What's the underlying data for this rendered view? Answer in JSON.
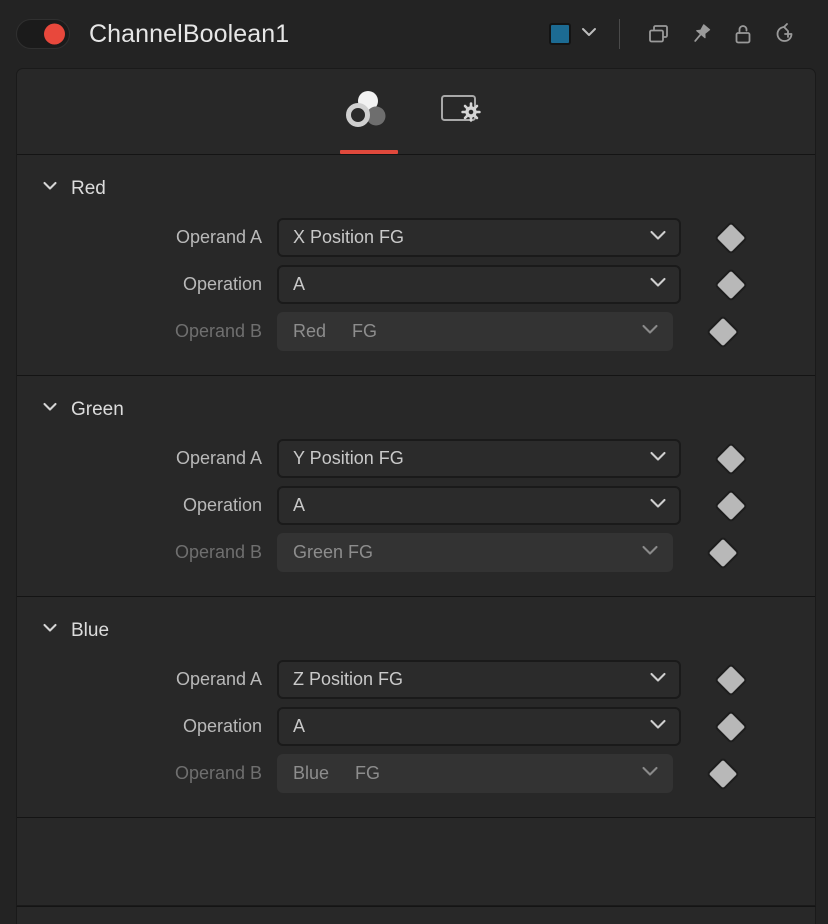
{
  "titlebar": {
    "node_enabled": true,
    "node_title": "ChannelBoolean1",
    "color_swatch": "#1c6b93",
    "swatch_caret_icon": "chevron-down-icon",
    "icons": [
      {
        "name": "duplicate-windows-icon",
        "label": "Duplicate"
      },
      {
        "name": "pin-icon",
        "label": "Pin"
      },
      {
        "name": "unlock-padlock-icon",
        "label": "Unlock"
      },
      {
        "name": "reset-history-icon",
        "label": "Reset"
      }
    ]
  },
  "tabs": [
    {
      "name": "tab-channels",
      "icon": "three-circles-icon",
      "active": true
    },
    {
      "name": "tab-settings",
      "icon": "screen-gear-icon",
      "active": false
    }
  ],
  "accent_color": "#e0493c",
  "sections": [
    {
      "title": "Red",
      "expanded": true,
      "rows": [
        {
          "label": "Operand A",
          "value": "X Position FG",
          "value2": "",
          "disabled": false,
          "keyframe": true
        },
        {
          "label": "Operation",
          "value": "A",
          "value2": "",
          "disabled": false,
          "keyframe": true
        },
        {
          "label": "Operand B",
          "value": "Red",
          "value2": "FG",
          "disabled": true,
          "keyframe": true
        }
      ]
    },
    {
      "title": "Green",
      "expanded": true,
      "rows": [
        {
          "label": "Operand A",
          "value": "Y Position FG",
          "value2": "",
          "disabled": false,
          "keyframe": true
        },
        {
          "label": "Operation",
          "value": "A",
          "value2": "",
          "disabled": false,
          "keyframe": true
        },
        {
          "label": "Operand B",
          "value": "Green FG",
          "value2": "",
          "disabled": true,
          "keyframe": true
        }
      ]
    },
    {
      "title": "Blue",
      "expanded": true,
      "rows": [
        {
          "label": "Operand A",
          "value": "Z Position FG",
          "value2": "",
          "disabled": false,
          "keyframe": true
        },
        {
          "label": "Operation",
          "value": "A",
          "value2": "",
          "disabled": false,
          "keyframe": true
        },
        {
          "label": "Operand B",
          "value": "Blue",
          "value2": "FG",
          "disabled": true,
          "keyframe": true
        }
      ]
    }
  ]
}
